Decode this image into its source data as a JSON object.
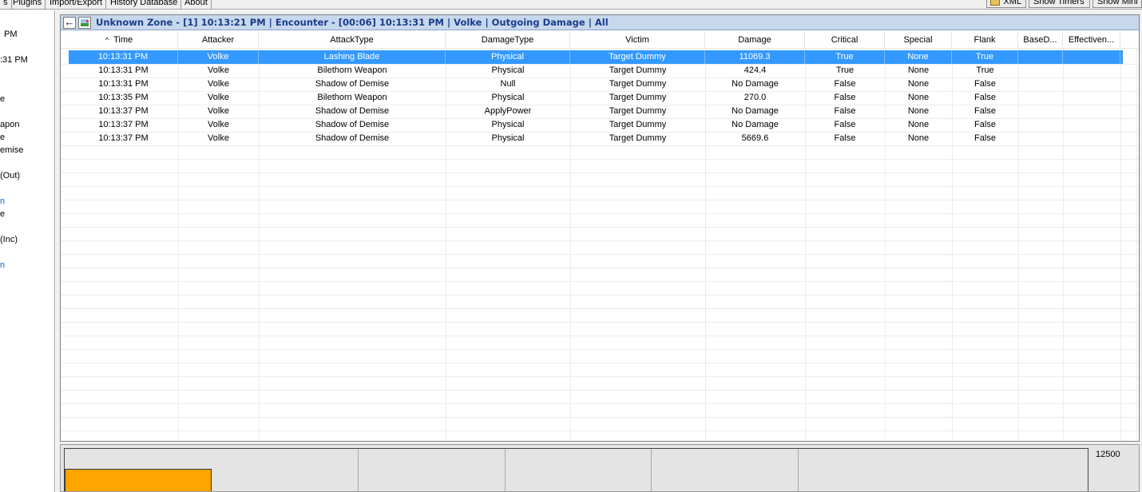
{
  "topbar": {
    "tabs": [
      "s",
      "Plugins",
      "Import/Export",
      "History Database",
      "About"
    ],
    "xml_label": "XML",
    "show_timers_label": "Show Timers",
    "show_mini_label": "Show Mini"
  },
  "left_tree": {
    "items": [
      "PM",
      ":31 PM",
      "e",
      "apon",
      "e",
      "emise",
      "(Out)",
      "n",
      "e",
      "(Inc)",
      "n"
    ]
  },
  "encounter": {
    "title": "Unknown Zone - [1] 10:13:21 PM | Encounter - [00:06] 10:13:31 PM | Volke | Outgoing Damage | All",
    "columns": [
      "Time",
      "Attacker",
      "AttackType",
      "DamageType",
      "Victim",
      "Damage",
      "Critical",
      "Special",
      "Flank",
      "BaseD...",
      "Effectiven..."
    ],
    "sort_indicator": "^",
    "rows": [
      [
        "10:13:31 PM",
        "Volke",
        "Lashing Blade",
        "Physical",
        "Target Dummy",
        "11069.3",
        "True",
        "None",
        "True",
        "",
        ""
      ],
      [
        "10:13:31 PM",
        "Volke",
        "Bilethorn Weapon",
        "Physical",
        "Target Dummy",
        "424.4",
        "True",
        "None",
        "True",
        "",
        ""
      ],
      [
        "10:13:31 PM",
        "Volke",
        "Shadow of Demise",
        "Null",
        "Target Dummy",
        "No Damage",
        "False",
        "None",
        "False",
        "",
        ""
      ],
      [
        "10:13:35 PM",
        "Volke",
        "Bilethorn Weapon",
        "Physical",
        "Target Dummy",
        "270.0",
        "False",
        "None",
        "False",
        "",
        ""
      ],
      [
        "10:13:37 PM",
        "Volke",
        "Shadow of Demise",
        "ApplyPower",
        "Target Dummy",
        "No Damage",
        "False",
        "None",
        "False",
        "",
        ""
      ],
      [
        "10:13:37 PM",
        "Volke",
        "Shadow of Demise",
        "Physical",
        "Target Dummy",
        "No Damage",
        "False",
        "None",
        "False",
        "",
        ""
      ],
      [
        "10:13:37 PM",
        "Volke",
        "Shadow of Demise",
        "Physical",
        "Target Dummy",
        "5669.6",
        "False",
        "None",
        "False",
        "",
        ""
      ]
    ],
    "selected_row": 0
  },
  "graph": {
    "y_max_label": "12500",
    "bar_color": "#ffa500"
  },
  "colors": {
    "selection": "#3399ff",
    "title_text": "#1a3c8c",
    "title_bg": "#c8d8ec"
  }
}
